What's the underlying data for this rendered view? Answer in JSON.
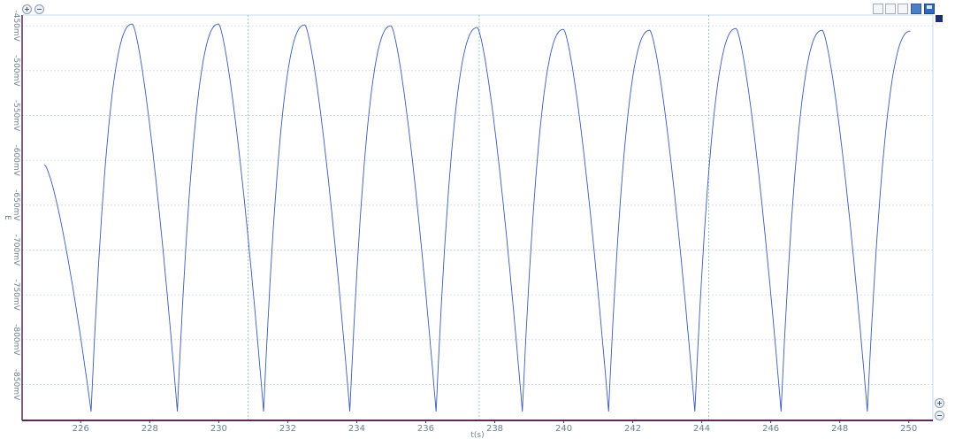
{
  "toolbar": {
    "zoom_in_icon": "zoom-in-icon",
    "zoom_out_icon": "zoom-out-icon",
    "buttons": [
      "fit-icon",
      "scale-icon",
      "cursor-icon",
      "chart-icon",
      "save-icon"
    ]
  },
  "colors": {
    "trace": "#3a5bb8",
    "grid": "#c9dbe3",
    "axis": "#5a2a5a",
    "cursor": "#8bb8c8",
    "tick_text": "#6a7f90",
    "legend": "#1f2f6e"
  },
  "chart_data": {
    "type": "line",
    "title": "",
    "xlabel": "t(s)",
    "ylabel": "E",
    "xlim": [
      224.3,
      250.7
    ],
    "ylim": [
      -890,
      -438
    ],
    "x_ticks": [
      226,
      228,
      230,
      232,
      234,
      236,
      238,
      240,
      242,
      244,
      246,
      248,
      250
    ],
    "x_tick_labels": [
      "226",
      "228",
      "230",
      "232",
      "234",
      "236",
      "238",
      "240",
      "242",
      "244",
      "246",
      "248",
      "250"
    ],
    "y_ticks": [
      -450,
      -500,
      -550,
      -600,
      -650,
      -700,
      -750,
      -800,
      -850
    ],
    "y_tick_labels": [
      "-450mV",
      "-500mV",
      "-550mV",
      "-600mV",
      "-650mV",
      "-700mV",
      "-750mV",
      "-800mV",
      "-850mV"
    ],
    "grid": true,
    "cursors_x": [
      230.85,
      237.55,
      244.2
    ],
    "series": [
      {
        "segments": [
          {
            "kind": "fall",
            "x_start": 224.95,
            "y_start": -605,
            "x_end": 226.3,
            "y_end": -880
          },
          {
            "kind": "rise",
            "x_start": 226.3,
            "y_start": -880,
            "x_end": 227.5,
            "y_end": -448
          },
          {
            "kind": "fall",
            "x_start": 227.5,
            "y_start": -448,
            "x_end": 228.8,
            "y_end": -880
          },
          {
            "kind": "rise",
            "x_start": 228.8,
            "y_start": -880,
            "x_end": 230.0,
            "y_end": -448
          },
          {
            "kind": "fall",
            "x_start": 230.0,
            "y_start": -448,
            "x_end": 231.3,
            "y_end": -880
          },
          {
            "kind": "rise",
            "x_start": 231.3,
            "y_start": -880,
            "x_end": 232.5,
            "y_end": -449
          },
          {
            "kind": "fall",
            "x_start": 232.5,
            "y_start": -449,
            "x_end": 233.8,
            "y_end": -880
          },
          {
            "kind": "rise",
            "x_start": 233.8,
            "y_start": -880,
            "x_end": 235.0,
            "y_end": -450
          },
          {
            "kind": "fall",
            "x_start": 235.0,
            "y_start": -450,
            "x_end": 236.3,
            "y_end": -880
          },
          {
            "kind": "rise",
            "x_start": 236.3,
            "y_start": -880,
            "x_end": 237.5,
            "y_end": -452
          },
          {
            "kind": "fall",
            "x_start": 237.5,
            "y_start": -452,
            "x_end": 238.8,
            "y_end": -880
          },
          {
            "kind": "rise",
            "x_start": 238.8,
            "y_start": -880,
            "x_end": 240.0,
            "y_end": -454
          },
          {
            "kind": "fall",
            "x_start": 240.0,
            "y_start": -454,
            "x_end": 241.3,
            "y_end": -880
          },
          {
            "kind": "rise",
            "x_start": 241.3,
            "y_start": -880,
            "x_end": 242.5,
            "y_end": -455
          },
          {
            "kind": "fall",
            "x_start": 242.5,
            "y_start": -455,
            "x_end": 243.8,
            "y_end": -880
          },
          {
            "kind": "rise",
            "x_start": 243.8,
            "y_start": -880,
            "x_end": 245.0,
            "y_end": -453
          },
          {
            "kind": "fall",
            "x_start": 245.0,
            "y_start": -453,
            "x_end": 246.3,
            "y_end": -880
          },
          {
            "kind": "rise",
            "x_start": 246.3,
            "y_start": -880,
            "x_end": 247.5,
            "y_end": -455
          },
          {
            "kind": "fall",
            "x_start": 247.5,
            "y_start": -455,
            "x_end": 248.8,
            "y_end": -880
          },
          {
            "kind": "rise",
            "x_start": 248.8,
            "y_start": -880,
            "x_end": 250.05,
            "y_end": -456
          }
        ]
      }
    ]
  }
}
